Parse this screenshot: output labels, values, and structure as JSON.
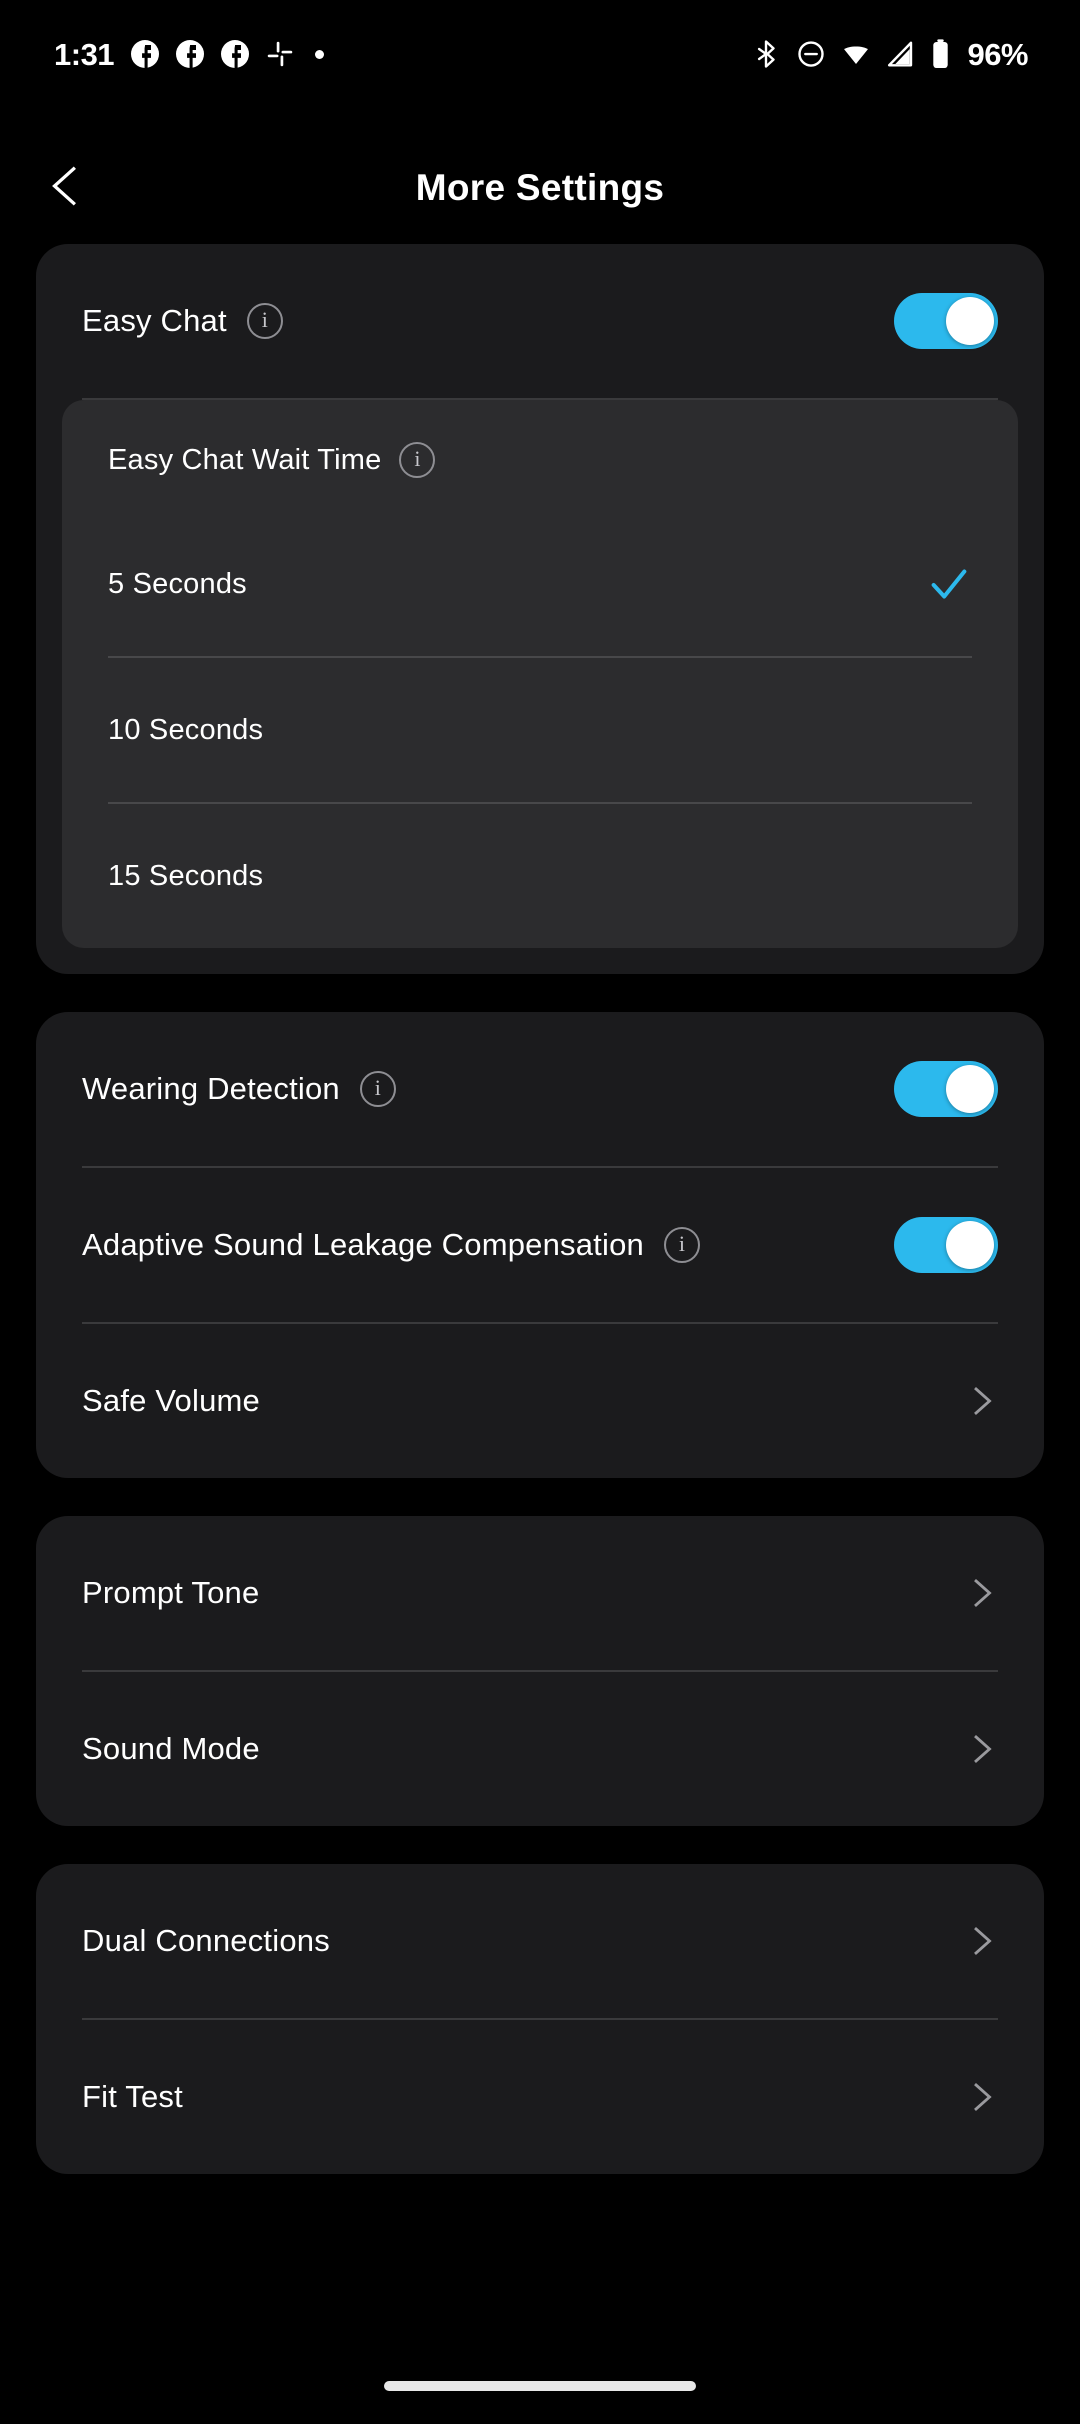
{
  "status_bar": {
    "time": "1:31",
    "left_icons": [
      "facebook-icon",
      "facebook-icon",
      "facebook-icon",
      "slack-icon",
      "dot-icon"
    ],
    "right_icons": [
      "bluetooth-icon",
      "do-not-disturb-icon",
      "wifi-icon",
      "cellular-signal-icon",
      "battery-icon"
    ],
    "battery_percent": "96%"
  },
  "header": {
    "back_icon": "chevron-left-icon",
    "title": "More Settings"
  },
  "colors": {
    "accent": "#2CB9ED",
    "background": "#000000",
    "card": "#1B1B1D",
    "subpanel": "#2C2C2E",
    "divider": "#3A3A3C",
    "chevron": "#9A9A9E"
  },
  "cards": [
    {
      "name": "easy-chat-card",
      "rows": [
        {
          "name": "easy-chat",
          "label": "Easy Chat",
          "info_icon": "info-icon",
          "control": "toggle",
          "toggle_on": true
        }
      ],
      "subpanel": {
        "name": "easy-chat-wait-time",
        "title": "Easy Chat Wait Time",
        "info_icon": "info-icon",
        "options": [
          {
            "label": "5 Seconds",
            "selected": true
          },
          {
            "label": "10 Seconds",
            "selected": false
          },
          {
            "label": "15 Seconds",
            "selected": false
          }
        ],
        "selected_value": "5 Seconds",
        "check_icon": "check-icon"
      }
    },
    {
      "name": "audio-card",
      "rows": [
        {
          "name": "wearing-detection",
          "label": "Wearing Detection",
          "info_icon": "info-icon",
          "control": "toggle",
          "toggle_on": true
        },
        {
          "name": "adaptive-sound-leakage-compensation",
          "label": "Adaptive Sound Leakage Compensation",
          "info_icon": "info-icon",
          "control": "toggle",
          "toggle_on": true
        },
        {
          "name": "safe-volume",
          "label": "Safe Volume",
          "info_icon": null,
          "control": "chevron"
        }
      ]
    },
    {
      "name": "tone-card",
      "rows": [
        {
          "name": "prompt-tone",
          "label": "Prompt Tone",
          "info_icon": null,
          "control": "chevron"
        },
        {
          "name": "sound-mode",
          "label": "Sound Mode",
          "info_icon": null,
          "control": "chevron"
        }
      ]
    },
    {
      "name": "connections-card",
      "rows": [
        {
          "name": "dual-connections",
          "label": "Dual Connections",
          "info_icon": null,
          "control": "chevron"
        },
        {
          "name": "fit-test",
          "label": "Fit Test",
          "info_icon": null,
          "control": "chevron"
        }
      ]
    }
  ],
  "home_indicator": "home-indicator"
}
